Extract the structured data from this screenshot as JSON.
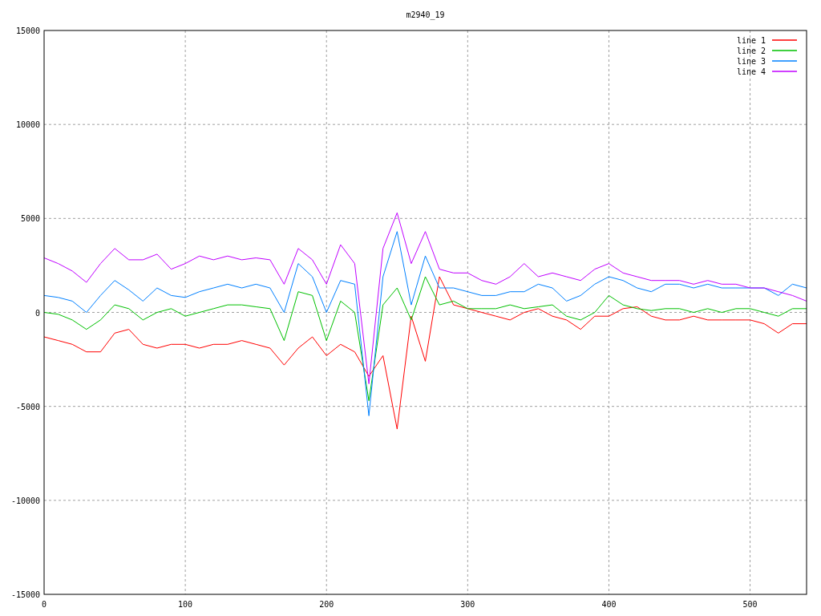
{
  "chart_data": {
    "type": "line",
    "title": "m2940_19",
    "x": [
      0,
      10,
      20,
      30,
      40,
      50,
      60,
      70,
      80,
      90,
      100,
      110,
      120,
      130,
      140,
      150,
      160,
      170,
      180,
      190,
      200,
      210,
      220,
      230,
      240,
      250,
      260,
      270,
      280,
      290,
      300,
      310,
      320,
      330,
      340,
      350,
      360,
      370,
      380,
      390,
      400,
      410,
      420,
      430,
      440,
      450,
      460,
      470,
      480,
      490,
      500,
      510,
      520,
      530,
      540
    ],
    "series": [
      {
        "name": "line 1",
        "color": "#ff0000",
        "values": [
          -1300,
          -1500,
          -1700,
          -2100,
          -2100,
          -1100,
          -900,
          -1700,
          -1900,
          -1700,
          -1700,
          -1900,
          -1700,
          -1700,
          -1500,
          -1700,
          -1900,
          -2800,
          -1900,
          -1300,
          -2300,
          -1700,
          -2100,
          -3400,
          -2300,
          -6200,
          -200,
          -2600,
          1900,
          400,
          200,
          0,
          -200,
          -400,
          0,
          200,
          -200,
          -400,
          -900,
          -200,
          -200,
          200,
          300,
          -200,
          -400,
          -400,
          -200,
          -400,
          -400,
          -400,
          -400,
          -600,
          -1100,
          -600,
          -600
        ]
      },
      {
        "name": "line 2",
        "color": "#00c000",
        "values": [
          0,
          -100,
          -400,
          -900,
          -400,
          400,
          200,
          -400,
          0,
          200,
          -200,
          0,
          200,
          400,
          400,
          300,
          200,
          -1500,
          1100,
          900,
          -1500,
          600,
          0,
          -4700,
          400,
          1300,
          -400,
          1900,
          400,
          600,
          200,
          200,
          200,
          400,
          200,
          300,
          400,
          -200,
          -400,
          0,
          900,
          400,
          200,
          100,
          200,
          200,
          0,
          200,
          0,
          200,
          200,
          0,
          -200,
          200,
          200
        ]
      },
      {
        "name": "line 3",
        "color": "#0080ff",
        "values": [
          900,
          800,
          600,
          0,
          900,
          1700,
          1200,
          600,
          1300,
          900,
          800,
          1100,
          1300,
          1500,
          1300,
          1500,
          1300,
          0,
          2600,
          1900,
          0,
          1700,
          1500,
          -5500,
          1900,
          4300,
          400,
          3000,
          1300,
          1300,
          1100,
          900,
          900,
          1100,
          1100,
          1500,
          1300,
          600,
          900,
          1500,
          1900,
          1700,
          1300,
          1100,
          1500,
          1500,
          1300,
          1500,
          1300,
          1300,
          1300,
          1300,
          900,
          1500,
          1300
        ]
      },
      {
        "name": "line 4",
        "color": "#c000ff",
        "values": [
          2900,
          2600,
          2200,
          1600,
          2600,
          3400,
          2800,
          2800,
          3100,
          2300,
          2600,
          3000,
          2800,
          3000,
          2800,
          2900,
          2800,
          1500,
          3400,
          2800,
          1500,
          3600,
          2600,
          -3800,
          3400,
          5300,
          2600,
          4300,
          2300,
          2100,
          2100,
          1700,
          1500,
          1900,
          2600,
          1900,
          2100,
          1900,
          1700,
          2300,
          2600,
          2100,
          1900,
          1700,
          1700,
          1700,
          1500,
          1700,
          1500,
          1500,
          1300,
          1300,
          1100,
          900,
          600
        ]
      }
    ],
    "grid": true,
    "legend": true,
    "xlim": [
      0,
      540
    ],
    "ylim": [
      -15000,
      15000
    ],
    "xticks": [
      0,
      100,
      200,
      300,
      400,
      500
    ],
    "yticks": [
      -15000,
      -10000,
      -5000,
      0,
      5000,
      10000,
      15000
    ]
  }
}
